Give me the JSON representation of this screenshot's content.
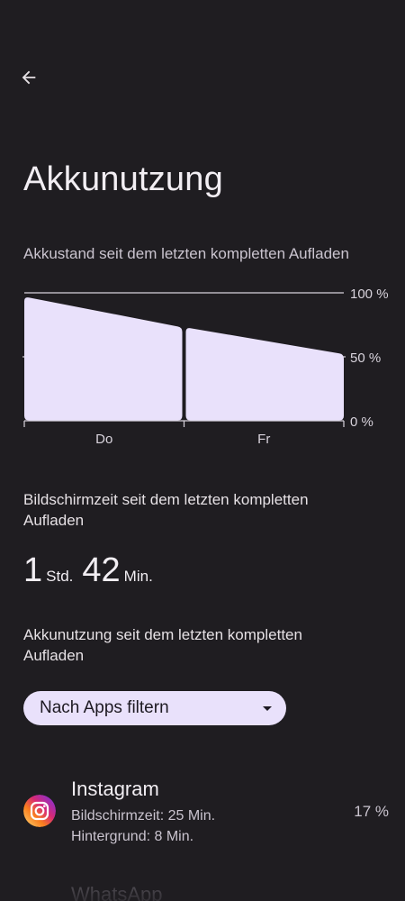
{
  "header": {
    "back_icon": "arrow-left-icon",
    "title": "Akkunutzung"
  },
  "battery_chart": {
    "caption": "Akkustand seit dem letzten kompletten Aufladen",
    "chart_data": {
      "type": "area",
      "title": "",
      "categories": [
        "Do",
        "Fr"
      ],
      "y_ticks": [
        "100 %",
        "50 %",
        "0 %"
      ],
      "ylim": [
        0,
        100
      ],
      "segments": [
        {
          "x": [
            0,
            1
          ],
          "values": [
            97,
            73
          ]
        },
        {
          "x": [
            1,
            2
          ],
          "values": [
            73,
            52
          ]
        }
      ],
      "fill_color": "#e9e1fb",
      "grid": true
    }
  },
  "screen_time": {
    "title": "Bildschirmzeit seit dem letzten kompletten Aufladen",
    "hours": "1",
    "hours_unit": "Std.",
    "minutes": "42",
    "minutes_unit": "Min."
  },
  "usage": {
    "title": "Akkunutzung seit dem letzten kompletten Aufladen",
    "filter_label": "Nach Apps filtern",
    "filter_icon": "dropdown-arrow-icon"
  },
  "apps": [
    {
      "name": "Instagram",
      "icon": "instagram-icon",
      "screen_time": "Bildschirmzeit: 25 Min.",
      "background": "Hintergrund: 8 Min.",
      "percent": "17 %"
    },
    {
      "name": "WhatsApp",
      "icon": "whatsapp-icon"
    }
  ],
  "colors": {
    "background": "#1f1d21",
    "accent": "#e9e1fb"
  }
}
